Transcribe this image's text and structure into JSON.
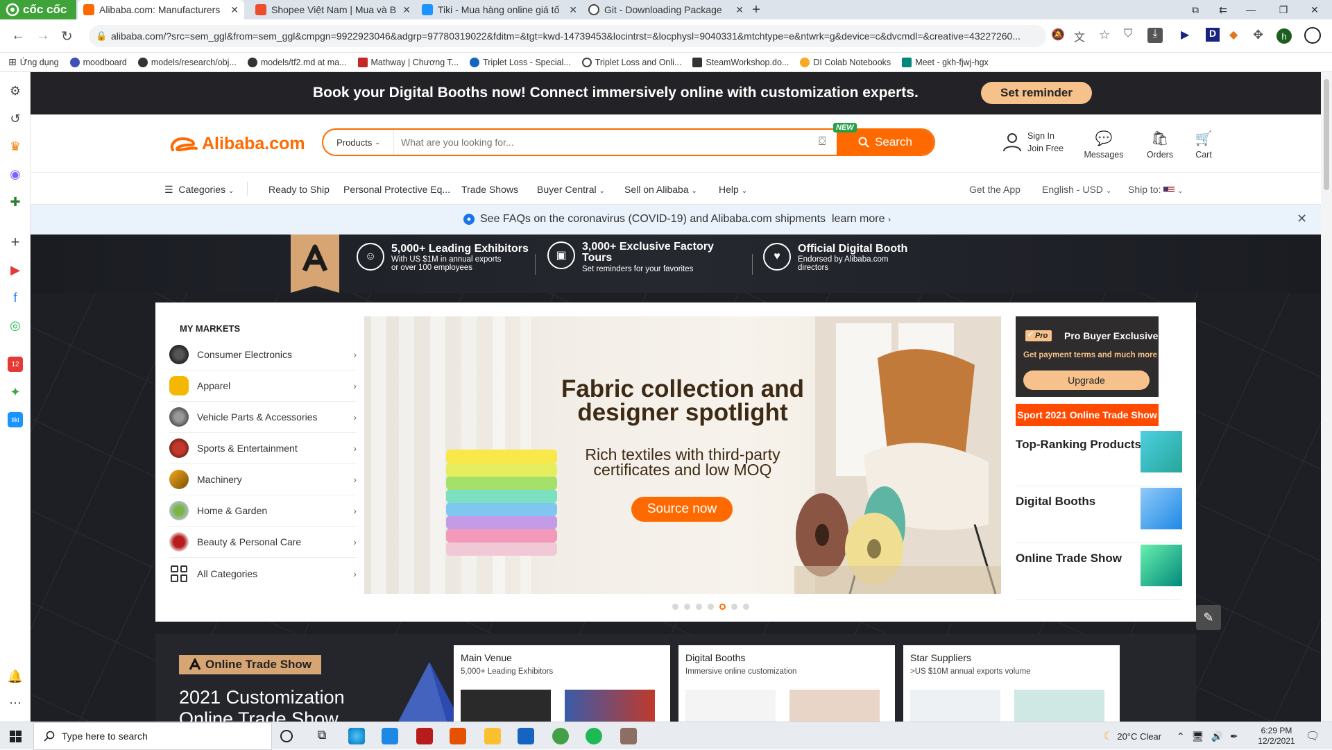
{
  "browser": {
    "brand": "cốc cốc",
    "tabs": [
      {
        "title": "Alibaba.com: Manufacturers",
        "active": true
      },
      {
        "title": "Shopee Việt Nam | Mua và B",
        "active": false
      },
      {
        "title": "Tiki - Mua hàng online giá tố",
        "active": false
      },
      {
        "title": "Git - Downloading Package",
        "active": false
      }
    ],
    "url": "alibaba.com/?src=sem_ggl&from=sem_ggl&cmpgn=9922923046&adgrp=97780319022&fditm=&tgt=kwd-14739453&locintrst=&locphysl=9040331&mtchtype=e&ntwrk=g&device=c&dvcmdl=&creative=43227260...",
    "profile_initial": "h",
    "bookmarks": [
      "Ứng dụng",
      "moodboard",
      "models/research/obj...",
      "models/tf2.md at ma...",
      "Mathway | Chương T...",
      "Triplet Loss - Special...",
      "Triplet Loss and Onli...",
      "SteamWorkshop.do...",
      "DI Colab Notebooks",
      "Meet - gkh-fjwj-hgx"
    ]
  },
  "promo": {
    "text": "Book your Digital Booths now! Connect immersively online with customization experts.",
    "button": "Set reminder"
  },
  "header": {
    "logo": "Alibaba.com",
    "search_category": "Products",
    "search_placeholder": "What are you looking for...",
    "new_tag": "NEW",
    "search_button": "Search",
    "sign_in": "Sign In",
    "join_free": "Join Free",
    "messages": "Messages",
    "orders": "Orders",
    "cart": "Cart"
  },
  "catbar": {
    "categories": "Categories",
    "items": [
      "Ready to Ship",
      "Personal Protective Eq...",
      "Trade Shows",
      "Buyer Central",
      "Sell on Alibaba",
      "Help"
    ],
    "get_app": "Get the App",
    "language": "English - USD",
    "ship_to": "Ship to:"
  },
  "covid": {
    "message": "See FAQs on the coronavirus (COVID-19) and Alibaba.com shipments",
    "link": "learn more"
  },
  "features": [
    {
      "title": "5,000+ Leading Exhibitors",
      "sub1": "With US $1M in annual exports",
      "sub2": "or over 100 employees"
    },
    {
      "title": "3,000+ Exclusive Factory",
      "title2": "Tours",
      "sub1": "Set reminders for your favorites"
    },
    {
      "title": "Official Digital Booth",
      "sub1": "Endorsed by Alibaba.com",
      "sub2": "directors"
    }
  ],
  "markets": {
    "title": "MY MARKETS",
    "items": [
      "Consumer Electronics",
      "Apparel",
      "Vehicle Parts & Accessories",
      "Sports & Entertainment",
      "Machinery",
      "Home & Garden",
      "Beauty & Personal Care",
      "All Categories"
    ]
  },
  "banner": {
    "title1": "Fabric collection and",
    "title2": "designer spotlight",
    "sub1": "Rich textiles with third-party",
    "sub2": "certificates and low MOQ",
    "button": "Source now",
    "slide_count": 7,
    "active_slide": 5
  },
  "right": {
    "pro_badge": "Pro",
    "pro_title": "Pro Buyer Exclusive",
    "pro_sub": "Get payment terms and much more",
    "pro_button": "Upgrade",
    "sport": "Sport 2021 Online Trade Show",
    "links": [
      "Top-Ranking Products",
      "Digital Booths",
      "Online Trade Show"
    ]
  },
  "bottom": {
    "ots_label": "Online Trade Show",
    "headline1": "2021 Customization",
    "headline2": "Online Trade Show",
    "cards": [
      {
        "title": "Main Venue",
        "sub": "5,000+ Leading Exhibitors"
      },
      {
        "title": "Digital Booths",
        "sub": "Immersive online customization"
      },
      {
        "title": "Star Suppliers",
        "sub": ">US $10M annual exports volume"
      }
    ]
  },
  "taskbar": {
    "search_placeholder": "Type here to search",
    "weather": "20°C  Clear",
    "time": "6:29 PM",
    "date": "12/2/2021"
  },
  "colors": {
    "brand": "#ff6a00",
    "gold": "#f6c18b",
    "dark": "#232327"
  }
}
